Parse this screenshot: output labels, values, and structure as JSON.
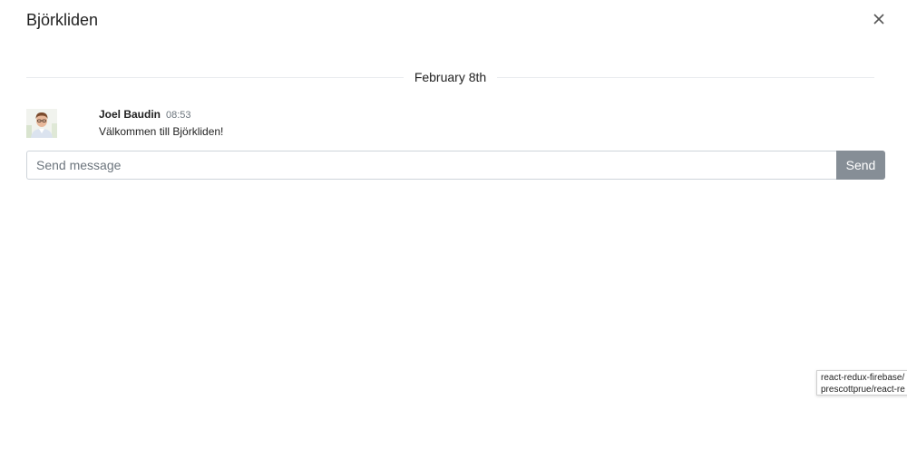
{
  "header": {
    "title": "Björkliden",
    "close_icon": "close-icon"
  },
  "chat": {
    "date_divider": "February 8th",
    "messages": [
      {
        "author": "Joel Baudin",
        "time": "08:53",
        "text": "Välkommen till Björkliden!",
        "avatar_icon": "user-avatar"
      }
    ]
  },
  "composer": {
    "placeholder": "Send message",
    "value": "",
    "send_label": "Send"
  },
  "tooltip": {
    "line1": "react-redux-firebase/",
    "line2": "prescottprue/react-re"
  },
  "colors": {
    "send_button_bg": "#868e96",
    "input_border": "#ced4da",
    "divider_line": "#e9ecef"
  }
}
